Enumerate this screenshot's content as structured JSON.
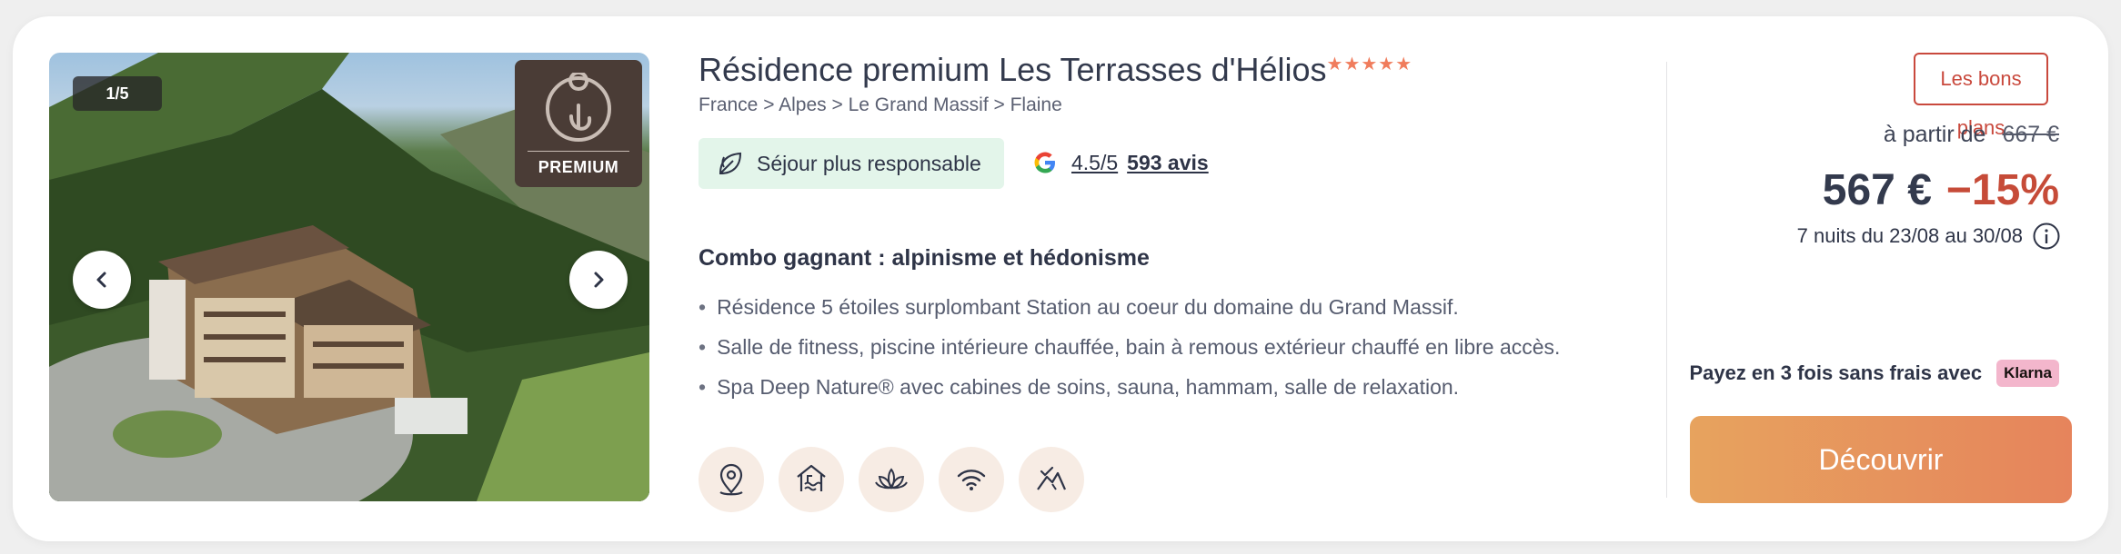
{
  "gallery": {
    "counter": "1/5",
    "badge_label": "PREMIUM",
    "prev_icon": "chevron-left-icon",
    "next_icon": "chevron-right-icon"
  },
  "listing": {
    "title": "Résidence premium Les Terrasses d'Hélios",
    "stars": "★★★★★",
    "breadcrumb": "France > Alpes > Le Grand Massif > Flaine",
    "eco_badge": "Séjour plus responsable",
    "rating_score": "4.5/5",
    "rating_reviews": "593 avis",
    "section_title": "Combo gagnant : alpinisme et hédonisme",
    "features": [
      "Résidence 5 étoiles surplombant Station au coeur du domaine du Grand Massif.",
      "Salle de fitness, piscine intérieure chauffée, bain à remous extérieur chauffé en libre accès.",
      "Spa Deep Nature® avec cabines de soins, sauna, hammam, salle de relaxation."
    ],
    "amenity_icons": [
      "location-pin-icon",
      "indoor-pool-icon",
      "spa-lotus-icon",
      "wifi-icon",
      "mountain-activity-icon"
    ]
  },
  "pricing": {
    "deals_tag": "Les bons plans",
    "from_label": "à partir de",
    "old_price": "667 €",
    "price": "567 €",
    "discount": "−15%",
    "dates": "7 nuits du 23/08 au 30/08",
    "installments": "Payez en 3 fois sans frais avec",
    "klarna": "Klarna",
    "cta": "Découvrir"
  },
  "colors": {
    "accent_red": "#c9493d",
    "cta_start": "#e7a35e",
    "cta_end": "#e6845c",
    "eco_bg": "#e3f5ea",
    "amenity_bg": "#f7ece4",
    "premium_bg": "#4a3c36"
  }
}
